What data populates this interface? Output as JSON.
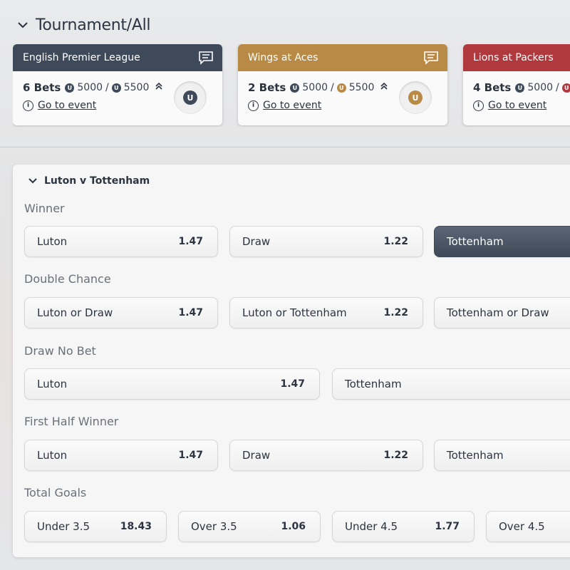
{
  "header": {
    "title": "Tournament/All"
  },
  "cards": [
    {
      "title": "English Premier League",
      "color": "#3e4a5a",
      "bets": "6 Bets",
      "amount1": "5000",
      "sep": "/",
      "amount2": "5500",
      "link": "Go to event"
    },
    {
      "title": "Wings at Aces",
      "color": "#b98a45",
      "bets": "2 Bets",
      "amount1": "5000",
      "sep": "/",
      "amount2": "5500",
      "link": "Go to event"
    },
    {
      "title": "Lions at Packers",
      "color": "#b0393d",
      "bets": "4 Bets",
      "amount1": "5000",
      "sep": "/",
      "amount2": "",
      "link": "Go to event"
    }
  ],
  "match": {
    "title": "Luton v Tottenham"
  },
  "sections": {
    "winner": {
      "label": "Winner",
      "options": [
        {
          "label": "Luton",
          "odd": "1.47"
        },
        {
          "label": "Draw",
          "odd": "1.22"
        },
        {
          "label": "Tottenham",
          "odd": ""
        }
      ]
    },
    "double_chance": {
      "label": "Double Chance",
      "options": [
        {
          "label": "Luton or Draw",
          "odd": "1.47"
        },
        {
          "label": "Luton or Tottenham",
          "odd": "1.22"
        },
        {
          "label": "Tottenham or Draw",
          "odd": ""
        }
      ]
    },
    "draw_no_bet": {
      "label": "Draw No Bet",
      "options": [
        {
          "label": "Luton",
          "odd": "1.47"
        },
        {
          "label": "Tottenham",
          "odd": ""
        }
      ]
    },
    "first_half_winner": {
      "label": "First Half Winner",
      "options": [
        {
          "label": "Luton",
          "odd": "1.47"
        },
        {
          "label": "Draw",
          "odd": "1.22"
        },
        {
          "label": "Tottenham",
          "odd": ""
        }
      ]
    },
    "total_goals": {
      "label": "Total Goals",
      "options": [
        {
          "label": "Under 3.5",
          "odd": "18.43"
        },
        {
          "label": "Over 3.5",
          "odd": "1.06"
        },
        {
          "label": "Under 4.5",
          "odd": "1.77"
        },
        {
          "label": "Over 4.5",
          "odd": ""
        }
      ]
    }
  },
  "icons": {
    "chevron": "chevron-down-icon",
    "chat": "chat-icon",
    "coin": "coin-icon",
    "info": "info-icon",
    "collapse": "double-chevron-up-icon"
  }
}
